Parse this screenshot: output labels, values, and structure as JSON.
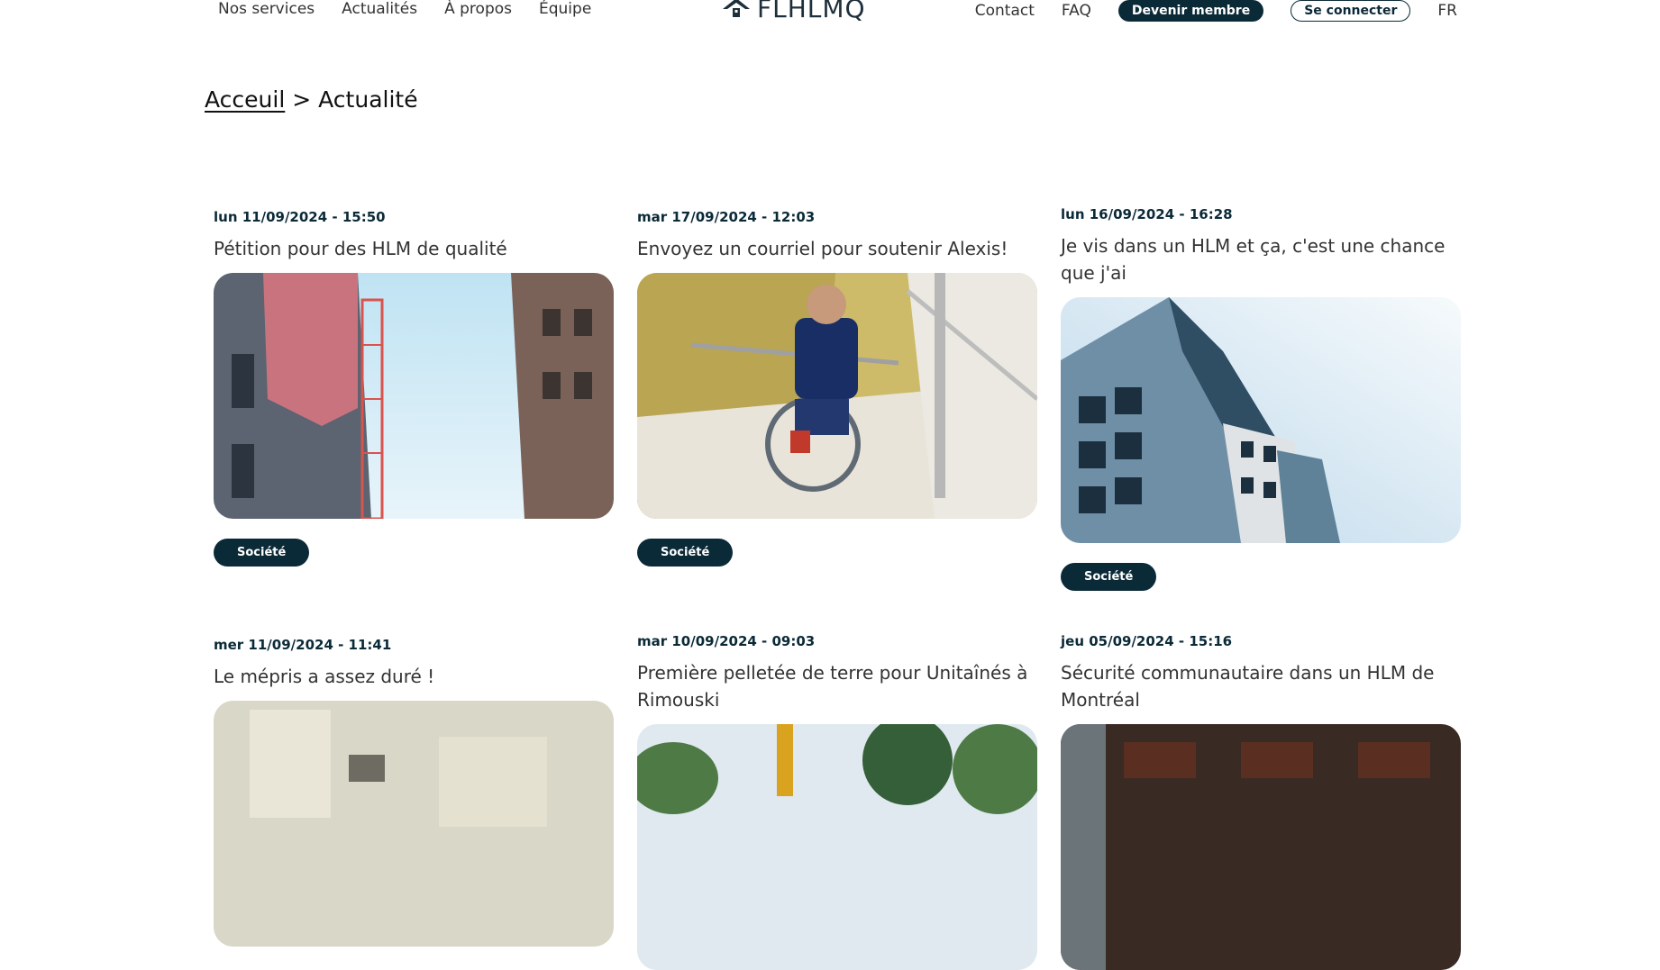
{
  "header": {
    "nav_left": [
      "Nos services",
      "Actualités",
      "À propos",
      "Équipe"
    ],
    "logo_text": "FLHLMQ",
    "nav_right": {
      "contact": "Contact",
      "faq": "FAQ",
      "member_button": "Devenir membre",
      "login_button": "Se connecter",
      "language": "FR"
    }
  },
  "breadcrumb": {
    "home": "Acceuil",
    "separator": ">",
    "current": "Actualité"
  },
  "articles": [
    {
      "date": "lun 11/09/2024 - 15:50",
      "title": "Pétition pour des HLM de qualité",
      "tag": "Société"
    },
    {
      "date": "mar 17/09/2024 - 12:03",
      "title": "Envoyez un courriel pour soutenir Alexis!",
      "tag": "Société"
    },
    {
      "date": "lun 16/09/2024 - 16:28",
      "title": "Je vis dans un HLM et ça, c'est une chance que j'ai",
      "tag": "Société"
    },
    {
      "date": "mer 11/09/2024 - 11:41",
      "title": "Le mépris a assez duré !",
      "tag": ""
    },
    {
      "date": "mar 10/09/2024 - 09:03",
      "title": "Première pelletée de terre pour Unitaînés à Rimouski",
      "tag": ""
    },
    {
      "date": "jeu 05/09/2024 - 15:16",
      "title": "Sécurité communautaire dans un HLM de Montréal",
      "tag": ""
    }
  ],
  "colors": {
    "primary": "#0b2a38",
    "text": "#333333"
  }
}
